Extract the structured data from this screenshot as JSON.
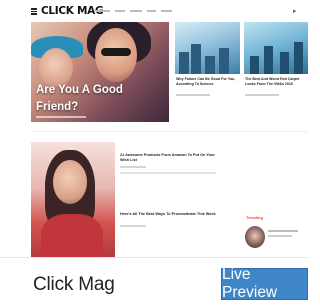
{
  "preview": {
    "site_logo": "CLICK MAG",
    "hero_title_line1": "Are You A Good",
    "hero_title_line2": "Friend?",
    "thumb_a_caption": "Why Failure Can Be Good For You, According To Science",
    "thumb_b_caption": "The Best And Worst Red Carpet Looks From The VMAs 2016",
    "item1_title": "21 Awesome Products From Amazon To Put On Your Wish List",
    "item2_title": "Here's All The Best Ways To Procrastinate This Week",
    "trending_label": "Trending",
    "colors": {
      "trending": "#e4472f",
      "button": "#3f86c8"
    }
  },
  "footer": {
    "theme_name": "Click Mag",
    "live_preview_label": "Live Preview"
  }
}
